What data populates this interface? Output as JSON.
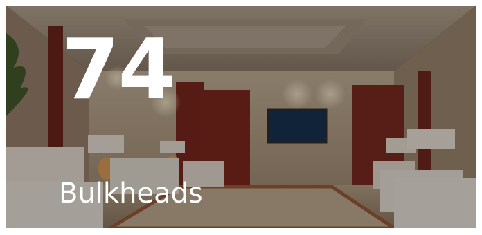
{
  "tile": {
    "count": "74",
    "label": "Bulkheads",
    "image_subject": "hotel-lobby-interior-photo"
  },
  "colors": {
    "text": "#ffffff",
    "overlay": "#140e0a"
  }
}
